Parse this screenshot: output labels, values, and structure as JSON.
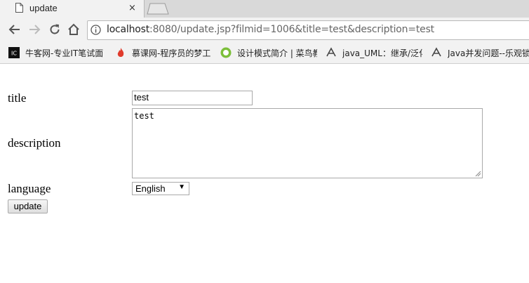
{
  "tab": {
    "title": "update",
    "close_glyph": "×"
  },
  "address": {
    "host": "localhost",
    "rest": ":8080/update.jsp?filmid=1006&title=test&description=test"
  },
  "bookmarks": [
    {
      "label": "牛客网-专业IT笔试面",
      "icon": "nowcoder-icon"
    },
    {
      "label": "慕课网-程序员的梦工",
      "icon": "imooc-flame-icon"
    },
    {
      "label": "设计模式简介 | 菜鸟教",
      "icon": "runoob-icon"
    },
    {
      "label": "java_UML：继承/泛化",
      "icon": "csdn-icon"
    },
    {
      "label": "Java并发问题--乐观锁",
      "icon": "csdn-icon"
    }
  ],
  "form": {
    "title_label": "title",
    "title_value": "test",
    "description_label": "description",
    "description_value": "test",
    "language_label": "language",
    "language_value": "English",
    "submit_label": "update"
  }
}
